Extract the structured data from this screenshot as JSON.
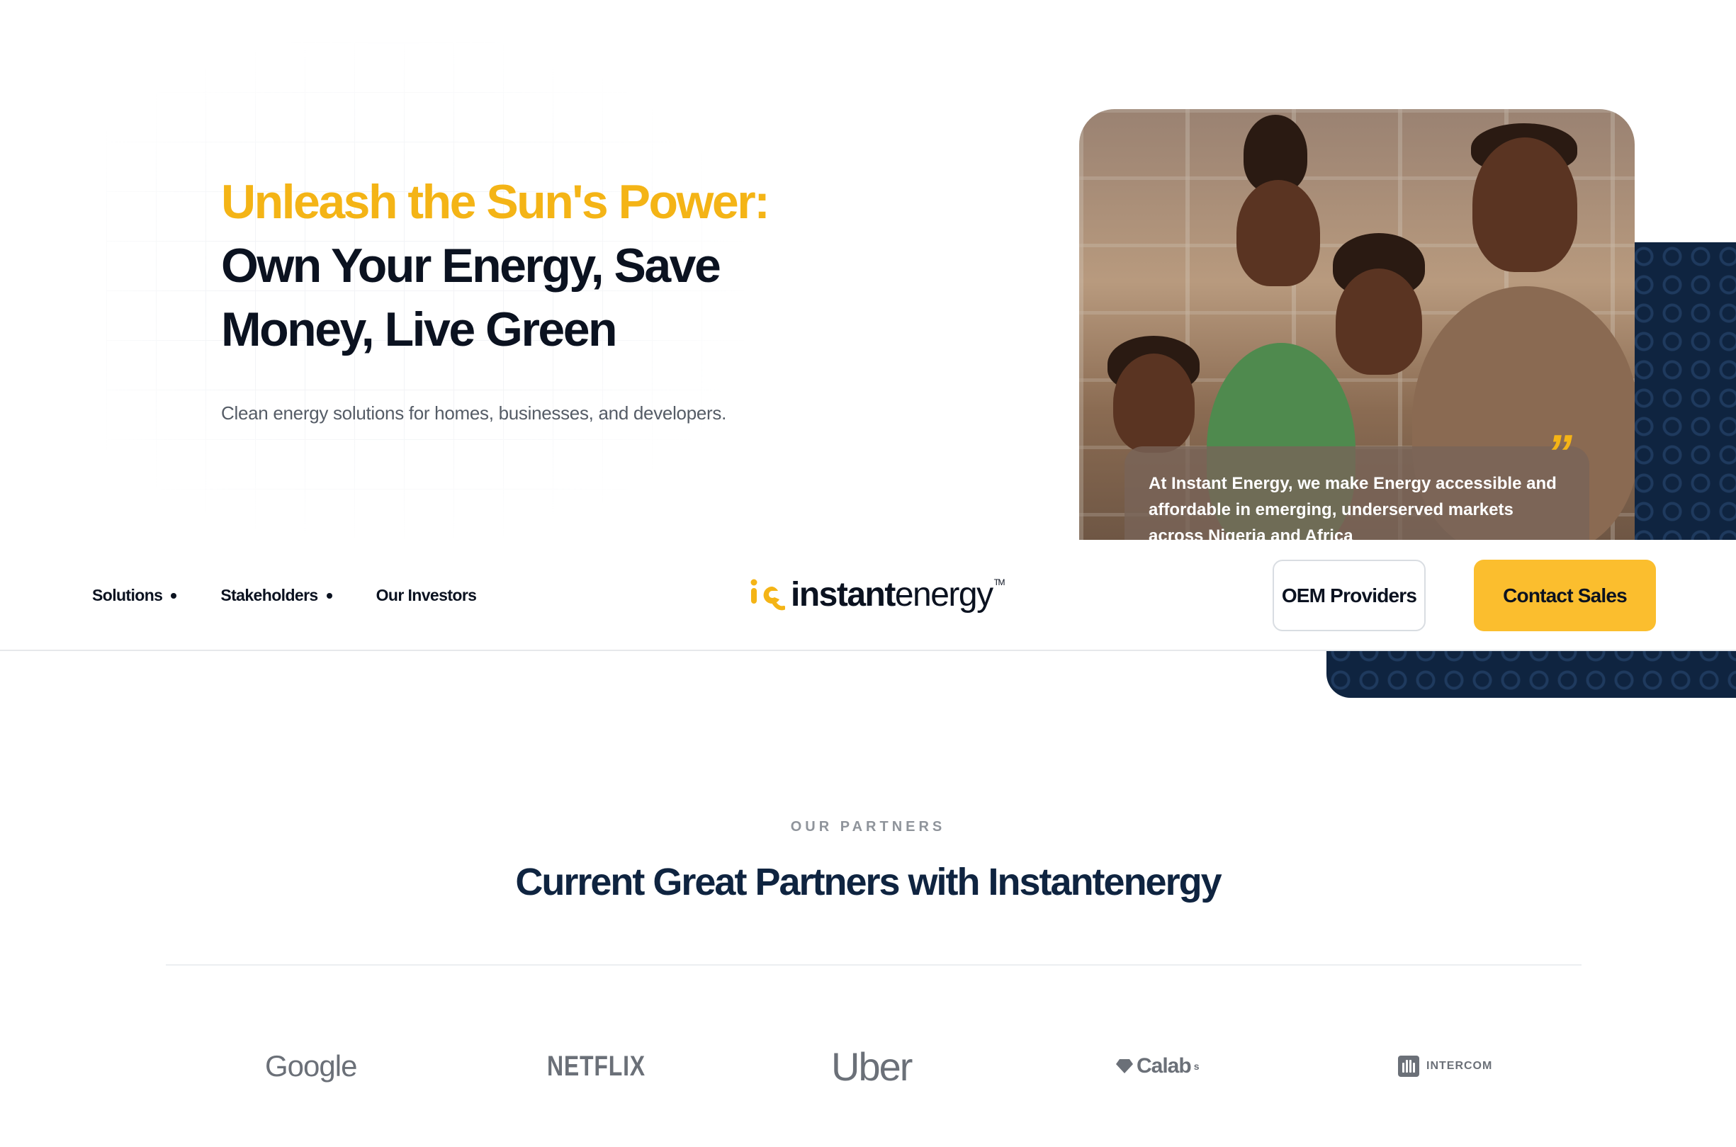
{
  "hero": {
    "headline_accent": "Unleash the Sun's Power:",
    "headline_line2": "Own Your Energy, Save",
    "headline_line3": "Money, Live Green",
    "subtitle": "Clean energy solutions for homes, businesses, and developers.",
    "quote": "At Instant Energy, we make Energy accessible and affordable in emerging, underserved markets across Nigeria and Africa",
    "quote_mark": "”"
  },
  "nav": {
    "items": [
      {
        "label": "Solutions",
        "has_dropdown": true
      },
      {
        "label": "Stakeholders",
        "has_dropdown": true
      },
      {
        "label": "Our Investors",
        "has_dropdown": false
      }
    ],
    "logo": {
      "bold": "instant",
      "light": "energy",
      "tm": "TM"
    },
    "buttons": {
      "oem": "OEM Providers",
      "contact": "Contact Sales"
    }
  },
  "partners": {
    "eyebrow": "OUR PARTNERS",
    "title": "Current Great Partners with Instantenergy",
    "logos": [
      "Google",
      "NETFLIX",
      "Uber",
      "Calab",
      "INTERCOM"
    ],
    "calab_suffix": "s"
  },
  "colors": {
    "accent": "#f4b416",
    "button": "#fbbe2e",
    "navy": "#0f2440",
    "text": "#0b1220"
  },
  "icons": [
    "chevron-dot-icon",
    "logo-mark-icon",
    "quote-icon",
    "calab-gem-icon",
    "intercom-icon"
  ]
}
